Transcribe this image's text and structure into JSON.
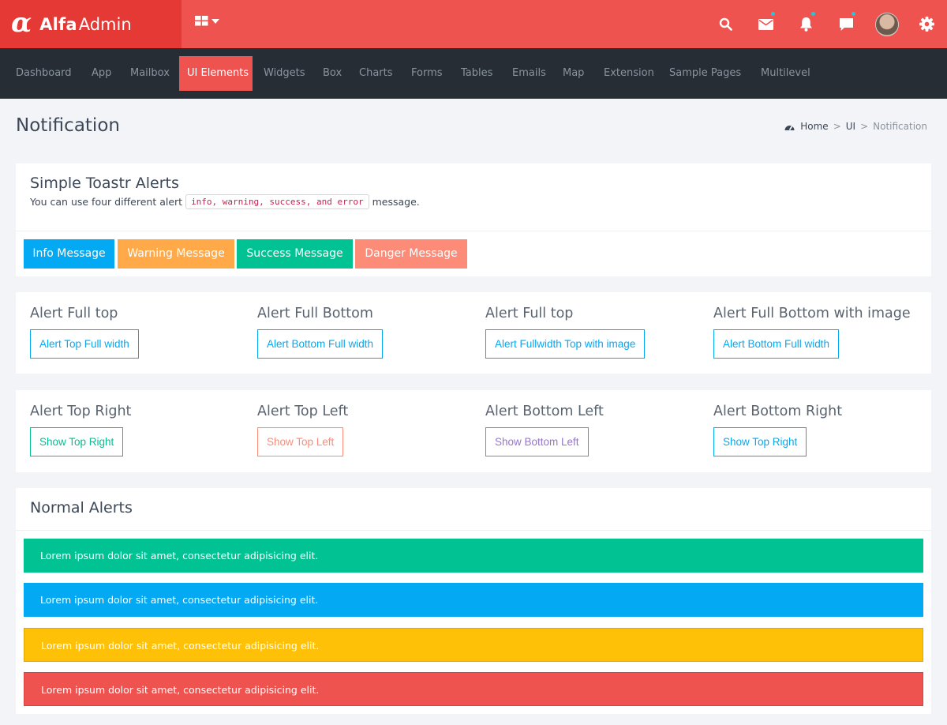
{
  "brand": {
    "part1": "Alfa",
    "part2": "Admin",
    "logo_glyph": "α"
  },
  "colors": {
    "primary": "#ef5350",
    "info": "#03a9f3",
    "warning": "#ffa949",
    "success": "#00c292",
    "danger": "#fc8b77",
    "purple": "#9675ce",
    "yellow": "#ffc107",
    "red": "#ef5350"
  },
  "topbar": {
    "icons": [
      "apps-icon",
      "search-icon",
      "mail-icon",
      "bell-icon",
      "chat-icon",
      "avatar",
      "gear-icon"
    ]
  },
  "nav": {
    "items": [
      {
        "label": "Dashboard"
      },
      {
        "label": "App"
      },
      {
        "label": "Mailbox"
      },
      {
        "label": "UI Elements"
      },
      {
        "label": "Widgets"
      },
      {
        "label": "Box"
      },
      {
        "label": "Charts"
      },
      {
        "label": "Forms"
      },
      {
        "label": "Tables"
      },
      {
        "label": "Emails"
      },
      {
        "label": "Map"
      },
      {
        "label": "Extension"
      },
      {
        "label": "Sample Pages"
      },
      {
        "label": "Multilevel"
      }
    ],
    "active": "UI Elements"
  },
  "page": {
    "title": "Notification",
    "breadcrumb": {
      "home": "Home",
      "section": "UI",
      "current": "Notification",
      "sep": ">"
    }
  },
  "toastr": {
    "title": "Simple Toastr Alerts",
    "desc_before": "You can use four different alert",
    "desc_code": "info, warning, success, and error",
    "desc_after": "message.",
    "buttons": [
      "Info Message",
      "Warning Message",
      "Success Message",
      "Danger Message"
    ]
  },
  "full": {
    "columns": [
      {
        "title": "Alert Full top",
        "button": "Alert Top Full width"
      },
      {
        "title": "Alert Full Bottom",
        "button": "Alert Bottom Full width"
      },
      {
        "title": "Alert Full top",
        "button": "Alert Fullwidth Top with image"
      },
      {
        "title": "Alert Full Bottom with image",
        "button": "Alert Bottom Full width"
      }
    ]
  },
  "positions": {
    "columns": [
      {
        "title": "Alert Top Right",
        "button": "Show Top Right"
      },
      {
        "title": "Alert Top Left",
        "button": "Show Top Left"
      },
      {
        "title": "Alert Bottom Left",
        "button": "Show Bottom Left"
      },
      {
        "title": "Alert Bottom Right",
        "button": "Show Top Right"
      }
    ]
  },
  "normal": {
    "title": "Normal Alerts",
    "alerts": [
      {
        "text": "Lorem ipsum dolor sit amet, consectetur adipisicing elit.",
        "variant": "success"
      },
      {
        "text": "Lorem ipsum dolor sit amet, consectetur adipisicing elit.",
        "variant": "info"
      },
      {
        "text": "Lorem ipsum dolor sit amet, consectetur adipisicing elit.",
        "variant": "warning"
      },
      {
        "text": "Lorem ipsum dolor sit amet, consectetur adipisicing elit.",
        "variant": "danger"
      }
    ]
  }
}
